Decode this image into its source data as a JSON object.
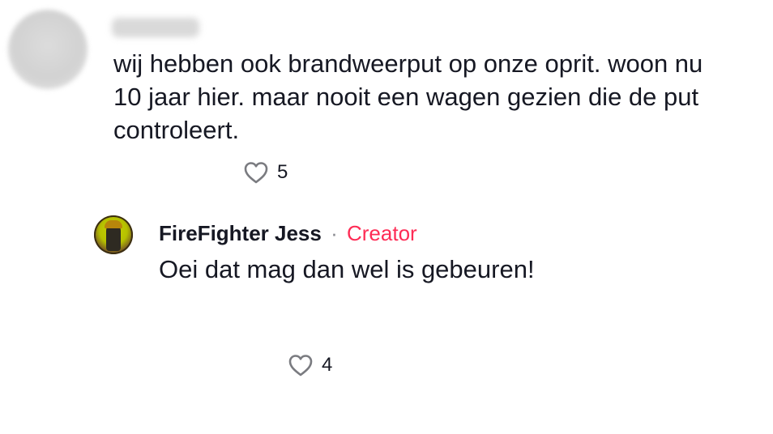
{
  "comment": {
    "text": "wij hebben ook brandweerput op onze oprit. woon nu\n10 jaar hier. maar nooit een wagen gezien die de put\ncontroleert.",
    "like_count": "5",
    "like_icon": "heart-outline-icon"
  },
  "reply": {
    "username": "FireFighter Jess",
    "separator": "·",
    "badge": "Creator",
    "text": "Oei dat mag dan wel is gebeuren!",
    "like_count": "4",
    "like_icon": "heart-outline-icon"
  },
  "colors": {
    "text": "#161823",
    "badge": "#fe2c55",
    "muted": "#8a8b91",
    "icon": "#7a7b80"
  }
}
